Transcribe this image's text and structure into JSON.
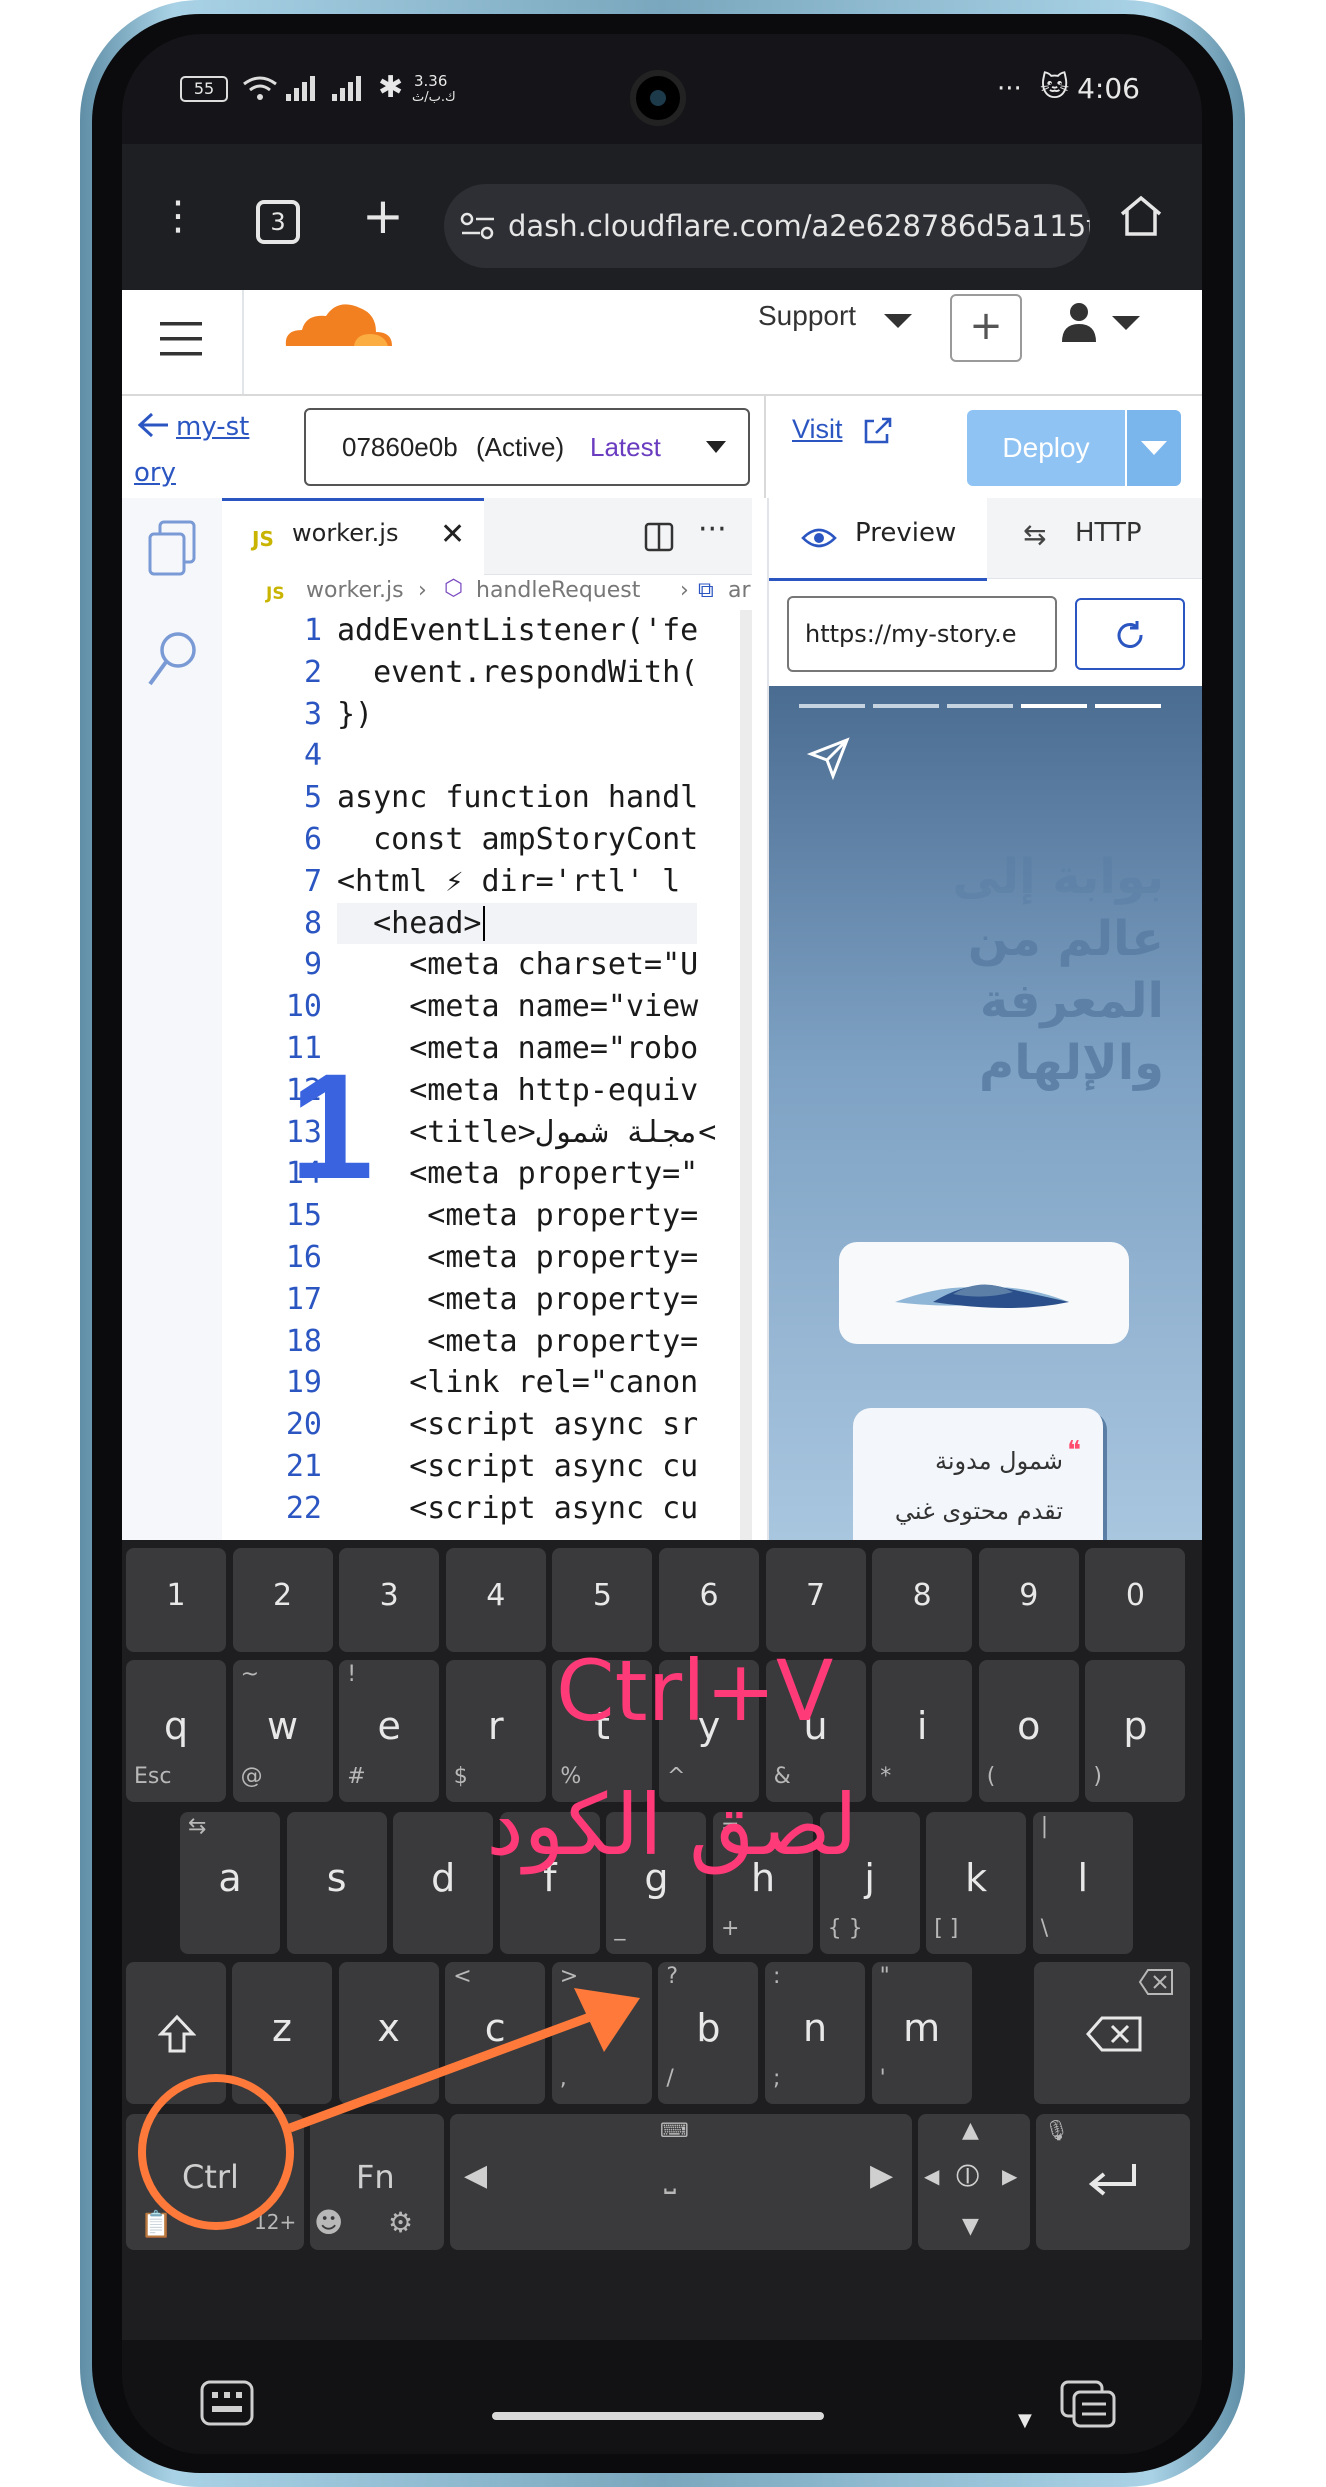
{
  "status_bar": {
    "battery": "55",
    "data_speed": "3.36",
    "data_unit": "ك.ب/ث",
    "more": "···",
    "time": "4:06"
  },
  "browser": {
    "tab_count": "3",
    "url": "dash.cloudflare.com/a2e628786d5a115f9b5"
  },
  "cloudflare_header": {
    "support_label": "Support"
  },
  "toolbar": {
    "back_label": "my-story",
    "version_id": "07860e0b",
    "version_status": "(Active)",
    "version_tag": "Latest",
    "visit_label": "Visit",
    "deploy_label": "Deploy"
  },
  "editor": {
    "file_tab": "worker.js",
    "file_icon": "JS",
    "breadcrumb_file": "worker.js",
    "breadcrumb_function": "handleRequest",
    "breadcrumb_more": "ar",
    "lines": [
      "addEventListener('fe",
      "  event.respondWith(",
      "})",
      "",
      "async function handl",
      "  const ampStoryCont",
      "<html ⚡ dir='rtl' l",
      "  <head>",
      "    <meta charset=\"U",
      "    <meta name=\"view",
      "    <meta name=\"robo",
      "    <meta http-equiv",
      "    <title>مجلة شمول<",
      "    <meta property=\"",
      "     <meta property=",
      "     <meta property=",
      "     <meta property=",
      "     <meta property=",
      "    <link rel=\"canon",
      "    <script async sr",
      "    <script async cu",
      "    <script async cu"
    ]
  },
  "preview_panel": {
    "preview_tab": "Preview",
    "http_tab": "HTTP",
    "url_value": "https://my-story.e",
    "story_heading_lines": [
      "بوابة إلى",
      "عالم من",
      "المعرفة",
      "والإلهام"
    ],
    "quote_mark": "❝",
    "quote_lines": [
      "شمول مدونة",
      "تقدم محتوى غني"
    ]
  },
  "keyboard": {
    "number_row": [
      "1",
      "2",
      "3",
      "4",
      "5",
      "6",
      "7",
      "8",
      "9",
      "0"
    ],
    "row1": [
      {
        "main": "q",
        "top": "",
        "sub": "Esc"
      },
      {
        "main": "w",
        "top": "~",
        "sub": "@"
      },
      {
        "main": "e",
        "top": "!",
        "sub": "#"
      },
      {
        "main": "r",
        "top": "",
        "sub": "$"
      },
      {
        "main": "t",
        "top": "",
        "sub": "%"
      },
      {
        "main": "y",
        "top": "",
        "sub": "^"
      },
      {
        "main": "u",
        "top": "",
        "sub": "&"
      },
      {
        "main": "i",
        "top": "",
        "sub": "*"
      },
      {
        "main": "o",
        "top": "",
        "sub": "("
      },
      {
        "main": "p",
        "top": "",
        "sub": ")"
      }
    ],
    "row2": [
      {
        "main": "a",
        "top": "⇆",
        "sub": ""
      },
      {
        "main": "s",
        "top": "",
        "sub": ""
      },
      {
        "main": "d",
        "top": "",
        "sub": ""
      },
      {
        "main": "f",
        "top": "",
        "sub": ""
      },
      {
        "main": "g",
        "top": "",
        "sub": "_"
      },
      {
        "main": "h",
        "top": "=",
        "sub": "+"
      },
      {
        "main": "j",
        "top": "",
        "sub": "{   }"
      },
      {
        "main": "k",
        "top": "",
        "sub": "[    ]"
      },
      {
        "main": "l",
        "top": "|",
        "sub": "\\"
      }
    ],
    "row3": [
      {
        "main": "z",
        "top": "",
        "sub": ""
      },
      {
        "main": "x",
        "top": "",
        "sub": ""
      },
      {
        "main": "c",
        "top": "<",
        "sub": ""
      },
      {
        "main": "v",
        "top": ">",
        "sub": ","
      },
      {
        "main": "b",
        "top": "?",
        "sub": "/"
      },
      {
        "main": "n",
        "top": ":",
        "sub": ";"
      },
      {
        "main": "m",
        "top": "\"",
        "sub": "'"
      }
    ],
    "ctrl_label": "Ctrl",
    "fn_label": "Fn",
    "sym_label": "12+"
  },
  "annotations": {
    "step_number": "1",
    "shortcut": "Ctrl+V",
    "caption": "لصق الكود"
  },
  "colors": {
    "cloudflare_orange": "#f38020",
    "annotation_pink": "#ff3a78",
    "annotation_orange": "#ff7a3a",
    "step_blue": "#3a63e0",
    "deploy_blue": "#8fc3f3",
    "link_blue": "#2b56c2"
  }
}
